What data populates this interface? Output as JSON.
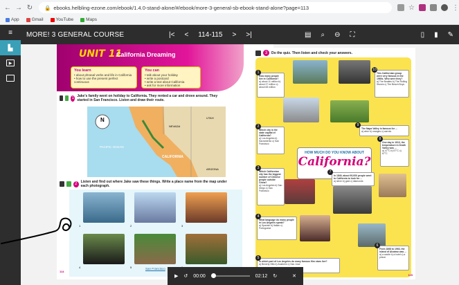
{
  "browser": {
    "url": "ebooks.helbling-ezone.com/ebook/1.4.0-stand-alone/#/ebook/more-3-general-sb-ebook-stand-alone?page=113",
    "bookmarks": [
      "App",
      "Gmail",
      "YouTube",
      "Maps"
    ]
  },
  "toolbar": {
    "book_title": "MORE! 3 GENERAL COURSE",
    "page_range": "114-115",
    "first": "|<",
    "prev": "<",
    "next": ">",
    "last": ">|"
  },
  "left_page": {
    "unit_label": "UNIT 11",
    "unit_title": "California Dreaming",
    "learn_head": "You learn",
    "learn_items": [
      "• about phrasal verbs and life in California",
      "• how to use the present perfect continuous"
    ],
    "can_head": "You can",
    "can_items": [
      "• talk about your holiday",
      "• write a postcard",
      "• write a text about California",
      "• ask for more information"
    ],
    "ex1_num": "1",
    "ex1_text": "Jake's family went on holiday to California. They rented a car and drove around. They started in San Francisco. Listen and draw their route.",
    "ex2_num": "2",
    "ex2_text": "Listen and find out where Jake saw these things. Write a place name from the map under each photograph.",
    "map_labels": {
      "pacific": "PACIFIC OCEAN",
      "california": "CALIFORNIA",
      "nevada": "NEVADA",
      "utah": "UTAH",
      "arizona": "ARIZONA",
      "north": "N"
    },
    "photo_caption": "San Francisco",
    "photo_nums": [
      "1",
      "2",
      "3",
      "4",
      "5",
      "6"
    ],
    "page_num": "114"
  },
  "right_page": {
    "ex_num": "3",
    "instruction": "Do the quiz. Then listen and check your answers.",
    "center_small": "HOW MUCH DO YOU KNOW ABOUT",
    "center_big": "California?",
    "questions": [
      {
        "n": "1",
        "text": "How many people live in California?",
        "opts": "a) about 11 million  b) about 37 million  c) about 68 million"
      },
      {
        "n": "2",
        "text": "Which city is the state capital of California?",
        "opts": "a) Los Angeles  b) Sacramento  c) San Francisco"
      },
      {
        "n": "3",
        "text": "Which Californian city has the biggest number of Chinese people outside China?",
        "opts": "a) Los Angeles  b) San Diego  c) San Francisco"
      },
      {
        "n": "4",
        "text": "What language do many people in Los Angeles speak?",
        "opts": "a) Spanish  b) Italian  c) Portuguese"
      },
      {
        "n": "5",
        "text": "In which part of Los Angeles do many famous film stars live?",
        "opts": "a) Beverly Hills  b) Anaheim  c) San Jose"
      },
      {
        "n": "6",
        "text": "From 1868 to 1963, the island of Alcatraz was ...",
        "opts": "a) a castle  b) a hotel  c) a prison"
      },
      {
        "n": "7",
        "text": "In 1849, about 90,000 people went to California to look for ...",
        "opts": "a) silver  b) gold  c) diamonds"
      },
      {
        "n": "8",
        "text": "One day in 1913, the temperature in Death Valley was ...",
        "opts": "a) 47°C  b) 57°C  c) 67°C"
      },
      {
        "n": "9",
        "text": "The Napa Valley is famous for ...",
        "opts": "a) wine  b) oranges  c) carrots"
      },
      {
        "n": "10",
        "text": "This Californian group were very famous in the 1960s. Who were they?",
        "opts": "a) The Beatles  b) The Rolling Stones  c) The Beach Boys"
      }
    ],
    "page_num": "115"
  },
  "audio": {
    "current": "00:00",
    "total": "02:12"
  },
  "colors": {
    "accent": "#d4007a",
    "quiz_bg": "#fbe34f",
    "toolbar": "#2d2d2d"
  }
}
